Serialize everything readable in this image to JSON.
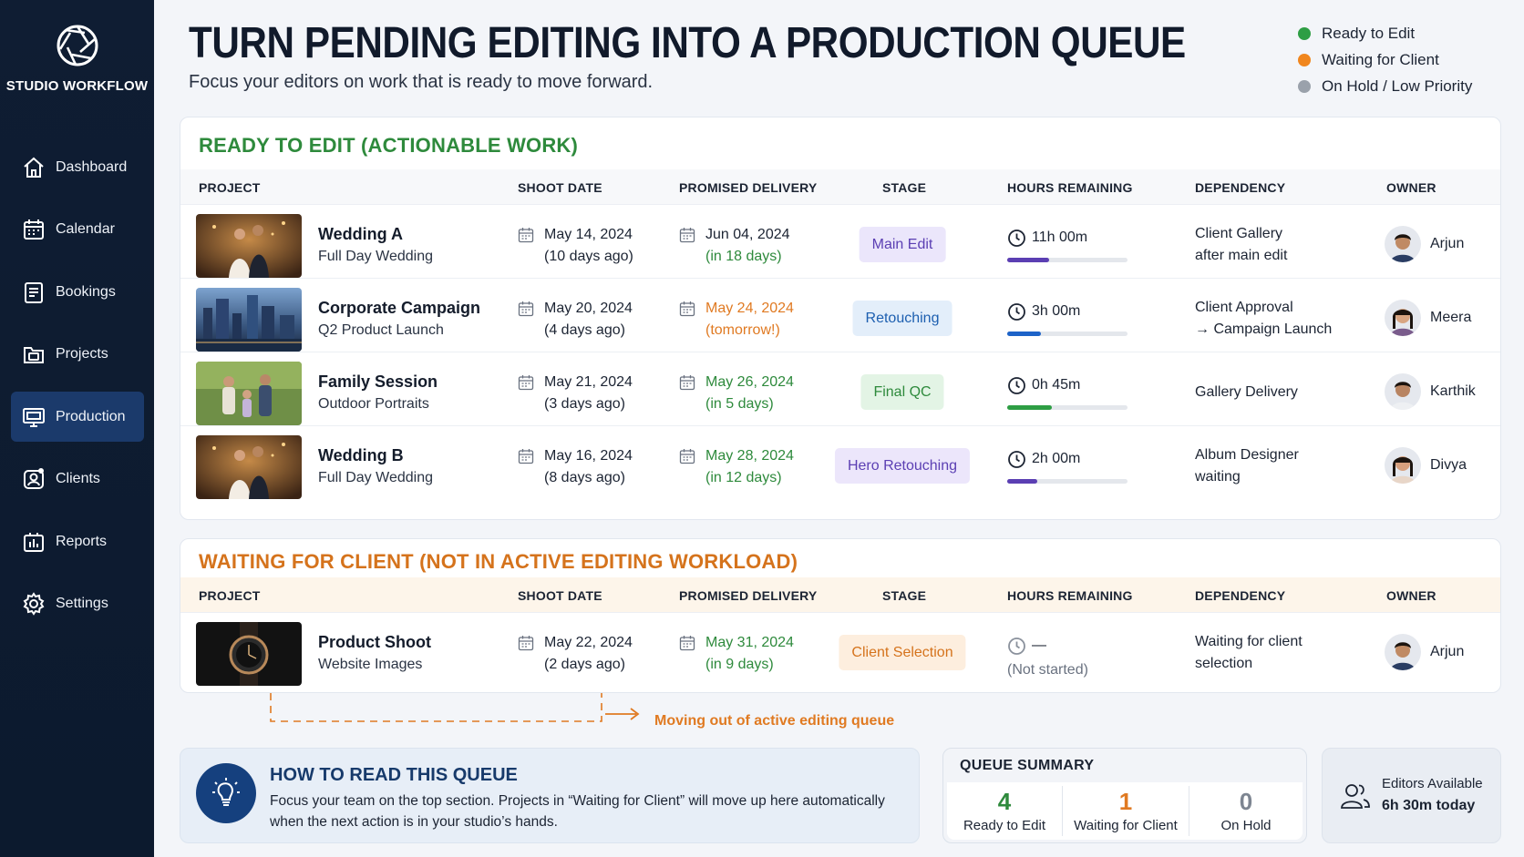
{
  "brand": {
    "name": "STUDIO WORKFLOW",
    "icon": "aperture-icon"
  },
  "nav": [
    {
      "label": "Dashboard",
      "icon": "home-icon",
      "active": false
    },
    {
      "label": "Calendar",
      "icon": "calendar-icon",
      "active": false
    },
    {
      "label": "Bookings",
      "icon": "clipboard-icon",
      "active": false
    },
    {
      "label": "Projects",
      "icon": "folder-icon",
      "active": false
    },
    {
      "label": "Production",
      "icon": "monitor-icon",
      "active": true
    },
    {
      "label": "Clients",
      "icon": "users-icon",
      "active": false
    },
    {
      "label": "Reports",
      "icon": "bar-chart-icon",
      "active": false
    },
    {
      "label": "Settings",
      "icon": "gear-icon",
      "active": false
    }
  ],
  "header": {
    "title": "TURN PENDING EDITING INTO A PRODUCTION QUEUE",
    "subtitle": "Focus your editors on work that is ready to move forward."
  },
  "legend": [
    {
      "label": "Ready to Edit",
      "color": "#2e9e44"
    },
    {
      "label": "Waiting for Client",
      "color": "#f0861e"
    },
    {
      "label": "On Hold / Low Priority",
      "color": "#9aa1ab"
    }
  ],
  "columns": {
    "project": "PROJECT",
    "shoot_date": "SHOOT DATE",
    "promised_delivery": "PROMISED DELIVERY",
    "stage": "STAGE",
    "hours_remaining": "HOURS REMAINING",
    "dependency": "DEPENDENCY",
    "owner": "OWNER"
  },
  "ready": {
    "title": "READY TO EDIT (ACTIONABLE WORK)",
    "rows": [
      {
        "name": "Wedding A",
        "sub": "Full Day Wedding",
        "thumb": "wedding-photo",
        "shoot_date": "May 14, 2024",
        "shoot_ago": "(10 days ago)",
        "delivery_date": "Jun 04, 2024",
        "delivery_rel": "(in 18 days)",
        "delivery_color": "#2e8a3c",
        "delivery_date_color": "#1c2433",
        "stage": "Main Edit",
        "stage_bg": "#ebe6fb",
        "stage_fg": "#5b3fb3",
        "hours": "11h 00m",
        "progress": 0.35,
        "progress_color": "#5b3fb3",
        "dependency_1": "Client Gallery",
        "dependency_2": "after main edit",
        "owner": "Arjun"
      },
      {
        "name": "Corporate Campaign",
        "sub": "Q2 Product Launch",
        "thumb": "city-photo",
        "shoot_date": "May 20, 2024",
        "shoot_ago": "(4 days ago)",
        "delivery_date": "May 24, 2024",
        "delivery_rel": "(tomorrow!)",
        "delivery_color": "#e07a22",
        "delivery_date_color": "#e07a22",
        "stage": "Retouching",
        "stage_bg": "#e3eefa",
        "stage_fg": "#1d5fb0",
        "hours": "3h 00m",
        "progress": 0.28,
        "progress_color": "#1d63c8",
        "dependency_1": "Client Approval",
        "dependency_2": "→ Campaign Launch",
        "owner": "Meera"
      },
      {
        "name": "Family Session",
        "sub": "Outdoor Portraits",
        "thumb": "family-photo",
        "shoot_date": "May 21, 2024",
        "shoot_ago": "(3 days ago)",
        "delivery_date": "May 26, 2024",
        "delivery_rel": "(in 5 days)",
        "delivery_color": "#2e8a3c",
        "delivery_date_color": "#2e8a3c",
        "stage": "Final QC",
        "stage_bg": "#e3f4e5",
        "stage_fg": "#2e8a3c",
        "hours": "0h 45m",
        "progress": 0.37,
        "progress_color": "#2e9e44",
        "dependency_1": "Gallery Delivery",
        "dependency_2": "",
        "owner": "Karthik"
      },
      {
        "name": "Wedding B",
        "sub": "Full Day Wedding",
        "thumb": "wedding-photo",
        "shoot_date": "May 16, 2024",
        "shoot_ago": "(8 days ago)",
        "delivery_date": "May 28, 2024",
        "delivery_rel": "(in 12 days)",
        "delivery_color": "#2e8a3c",
        "delivery_date_color": "#2e8a3c",
        "stage": "Hero Retouching",
        "stage_bg": "#ece6fb",
        "stage_fg": "#5b3fb3",
        "hours": "2h 00m",
        "progress": 0.25,
        "progress_color": "#5b3fb3",
        "dependency_1": "Album Designer",
        "dependency_2": "waiting",
        "owner": "Divya"
      }
    ]
  },
  "waiting": {
    "title": "WAITING FOR CLIENT (NOT IN ACTIVE EDITING WORKLOAD)",
    "rows": [
      {
        "name": "Product Shoot",
        "sub": "Website Images",
        "thumb": "watch-photo",
        "shoot_date": "May 22, 2024",
        "shoot_ago": "(2 days ago)",
        "delivery_date": "May 31, 2024",
        "delivery_rel": "(in 9 days)",
        "delivery_color": "#2e8a3c",
        "delivery_date_color": "#2e8a3c",
        "stage": "Client Selection",
        "stage_bg": "#fdeede",
        "stage_fg": "#d5731c",
        "hours": "—",
        "hours_note": "(Not started)",
        "dependency_1": "Waiting for client",
        "dependency_2": "selection",
        "owner": "Arjun"
      }
    ]
  },
  "flow_label": "Moving out of active editing queue",
  "how": {
    "title": "HOW TO READ THIS QUEUE",
    "text": "Focus your team on the top section. Projects in “Waiting for Client” will move up here automatically when the next action is in your studio’s hands.",
    "icon": "lightbulb-icon"
  },
  "summary": {
    "title": "QUEUE SUMMARY",
    "items": [
      {
        "value": "4",
        "label": "Ready to Edit",
        "color": "#2e8a3c"
      },
      {
        "value": "1",
        "label": "Waiting for Client",
        "color": "#e07a22"
      },
      {
        "value": "0",
        "label": "On Hold",
        "color": "#7d8591"
      }
    ]
  },
  "editors": {
    "label": "Editors Available",
    "value": "6h 30m today",
    "icon": "users-icon"
  }
}
